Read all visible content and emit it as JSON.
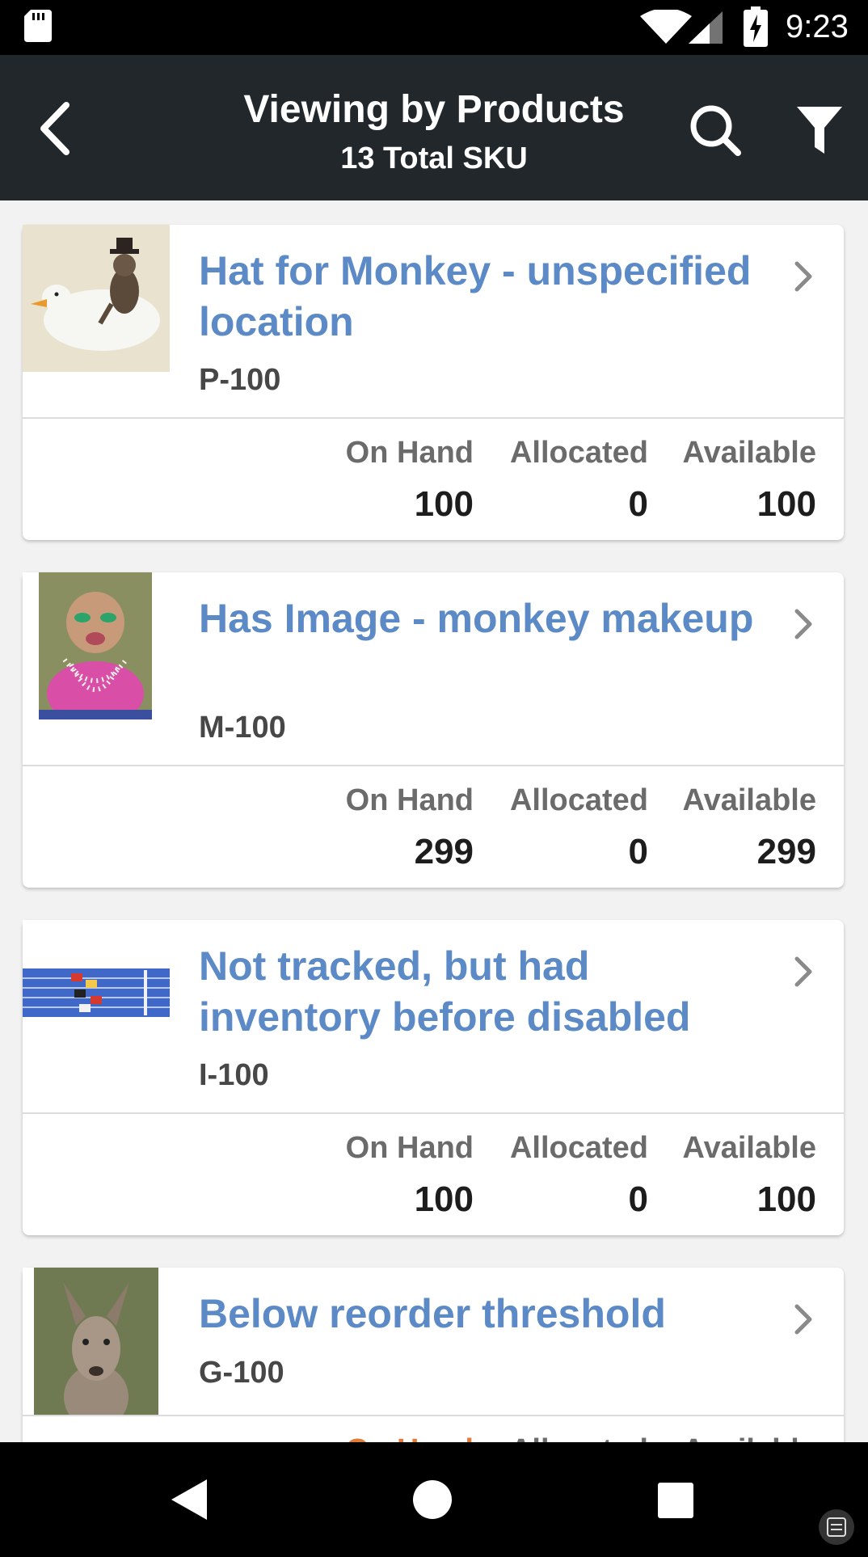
{
  "status_bar": {
    "time": "9:23",
    "icons": [
      "sd-card-icon",
      "wifi-icon",
      "cell-signal-icon",
      "battery-charging-icon"
    ]
  },
  "app_bar": {
    "title": "Viewing by Products",
    "subtitle": "13 Total SKU",
    "icons": [
      "back-arrow-icon",
      "search-icon",
      "filter-icon"
    ]
  },
  "stat_labels": {
    "on_hand": "On Hand",
    "allocated": "Allocated",
    "available": "Available"
  },
  "products": [
    {
      "name": "Hat for Monkey - unspecified location",
      "sku": "P-100",
      "on_hand": "100",
      "allocated": "0",
      "available": "100",
      "thumb": "monkey-riding-duck-image"
    },
    {
      "name": "Has Image - monkey makeup",
      "sku": "M-100",
      "on_hand": "299",
      "allocated": "0",
      "available": "299",
      "thumb": "monkey-with-makeup-image"
    },
    {
      "name": "Not tracked, but had inventory before disabled",
      "sku": "I-100",
      "on_hand": "100",
      "allocated": "0",
      "available": "100",
      "thumb": "runners-on-track-image"
    },
    {
      "name": "Below reorder threshold",
      "sku": "G-100",
      "on_hand": "",
      "allocated": "",
      "available": "",
      "thumb": "kangaroo-image",
      "on_hand_color": "#e07b39"
    }
  ],
  "colors": {
    "app_bar": "#22272b",
    "product_name": "#5b8ac6",
    "warning": "#e07b39"
  },
  "nav_bar": {
    "icons": [
      "nav-back-icon",
      "nav-home-icon",
      "nav-recents-icon",
      "screenshot-icon"
    ]
  }
}
